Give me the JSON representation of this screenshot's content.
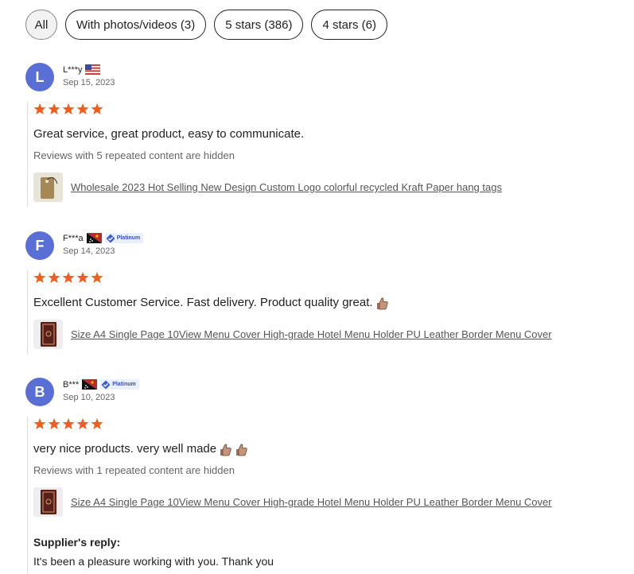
{
  "filters": [
    {
      "label": "All"
    },
    {
      "label": "With photos/videos (3)"
    },
    {
      "label": "5 stars (386)"
    },
    {
      "label": "4 stars (6)"
    }
  ],
  "colors": {
    "star": "#f35c1a",
    "avatar": "#5a6fd6",
    "link": "#555555"
  },
  "reviews": [
    {
      "initial": "L",
      "name": "L***y",
      "flag": "us-flag",
      "date": "Sep 15, 2023",
      "rating": 5,
      "text": "Great service, great product, easy to communicate.",
      "hidden_note": "Reviews with 5 repeated content are hidden",
      "product": "Wholesale 2023 Hot Selling New Design Custom Logo colorful recycled Kraft Paper hang tags"
    },
    {
      "initial": "F",
      "name": "F***a",
      "flag": "papua-new-guinea-flag",
      "badge": "Platinum",
      "date": "Sep 14, 2023",
      "rating": 5,
      "text": "Excellent Customer Service. Fast delivery. Product quality great.",
      "product": "Size A4 Single Page 10View Menu Cover High-grade Hotel Menu Holder PU Leather Border Menu Cover"
    },
    {
      "initial": "B",
      "name": "B***",
      "flag": "papua-new-guinea-flag",
      "badge": "Platinum",
      "date": "Sep 10, 2023",
      "rating": 5,
      "text": "very nice products. very well made",
      "hidden_note": "Reviews with 1 repeated content are hidden",
      "product": "Size A4 Single Page 10View Menu Cover High-grade Hotel Menu Holder PU Leather Border Menu Cover",
      "reply_title": "Supplier's reply:",
      "reply_text": "It's been a pleasure working with you. Thank you"
    }
  ]
}
